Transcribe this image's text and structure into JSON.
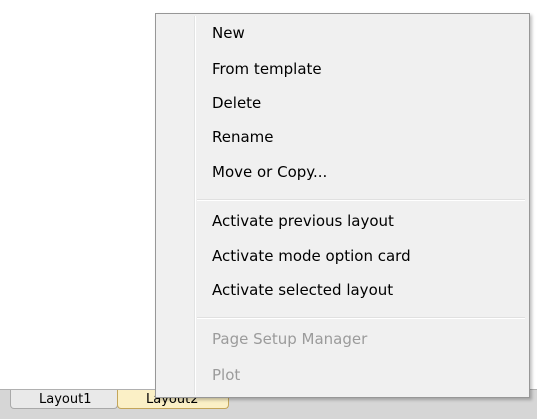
{
  "context_menu": {
    "items": [
      {
        "label": "New",
        "enabled": true
      },
      {
        "label": "From template",
        "enabled": true
      },
      {
        "label": "Delete",
        "enabled": true
      },
      {
        "label": "Rename",
        "enabled": true
      },
      {
        "label": "Move or Copy...",
        "enabled": true
      },
      {
        "label": "Activate previous layout",
        "enabled": true
      },
      {
        "label": "Activate mode option card",
        "enabled": true
      },
      {
        "label": "Activate selected layout",
        "enabled": true
      },
      {
        "label": "Page Setup Manager",
        "enabled": false
      },
      {
        "label": "Plot",
        "enabled": false
      }
    ]
  },
  "layout_tabs": {
    "items": [
      {
        "label": "Layout1",
        "active": false
      },
      {
        "label": "Layout2",
        "active": true
      }
    ]
  },
  "colors": {
    "menu_background": "#f0f0f0",
    "disabled_text": "#9b9b9b",
    "active_tab": "#fbf0c6"
  }
}
